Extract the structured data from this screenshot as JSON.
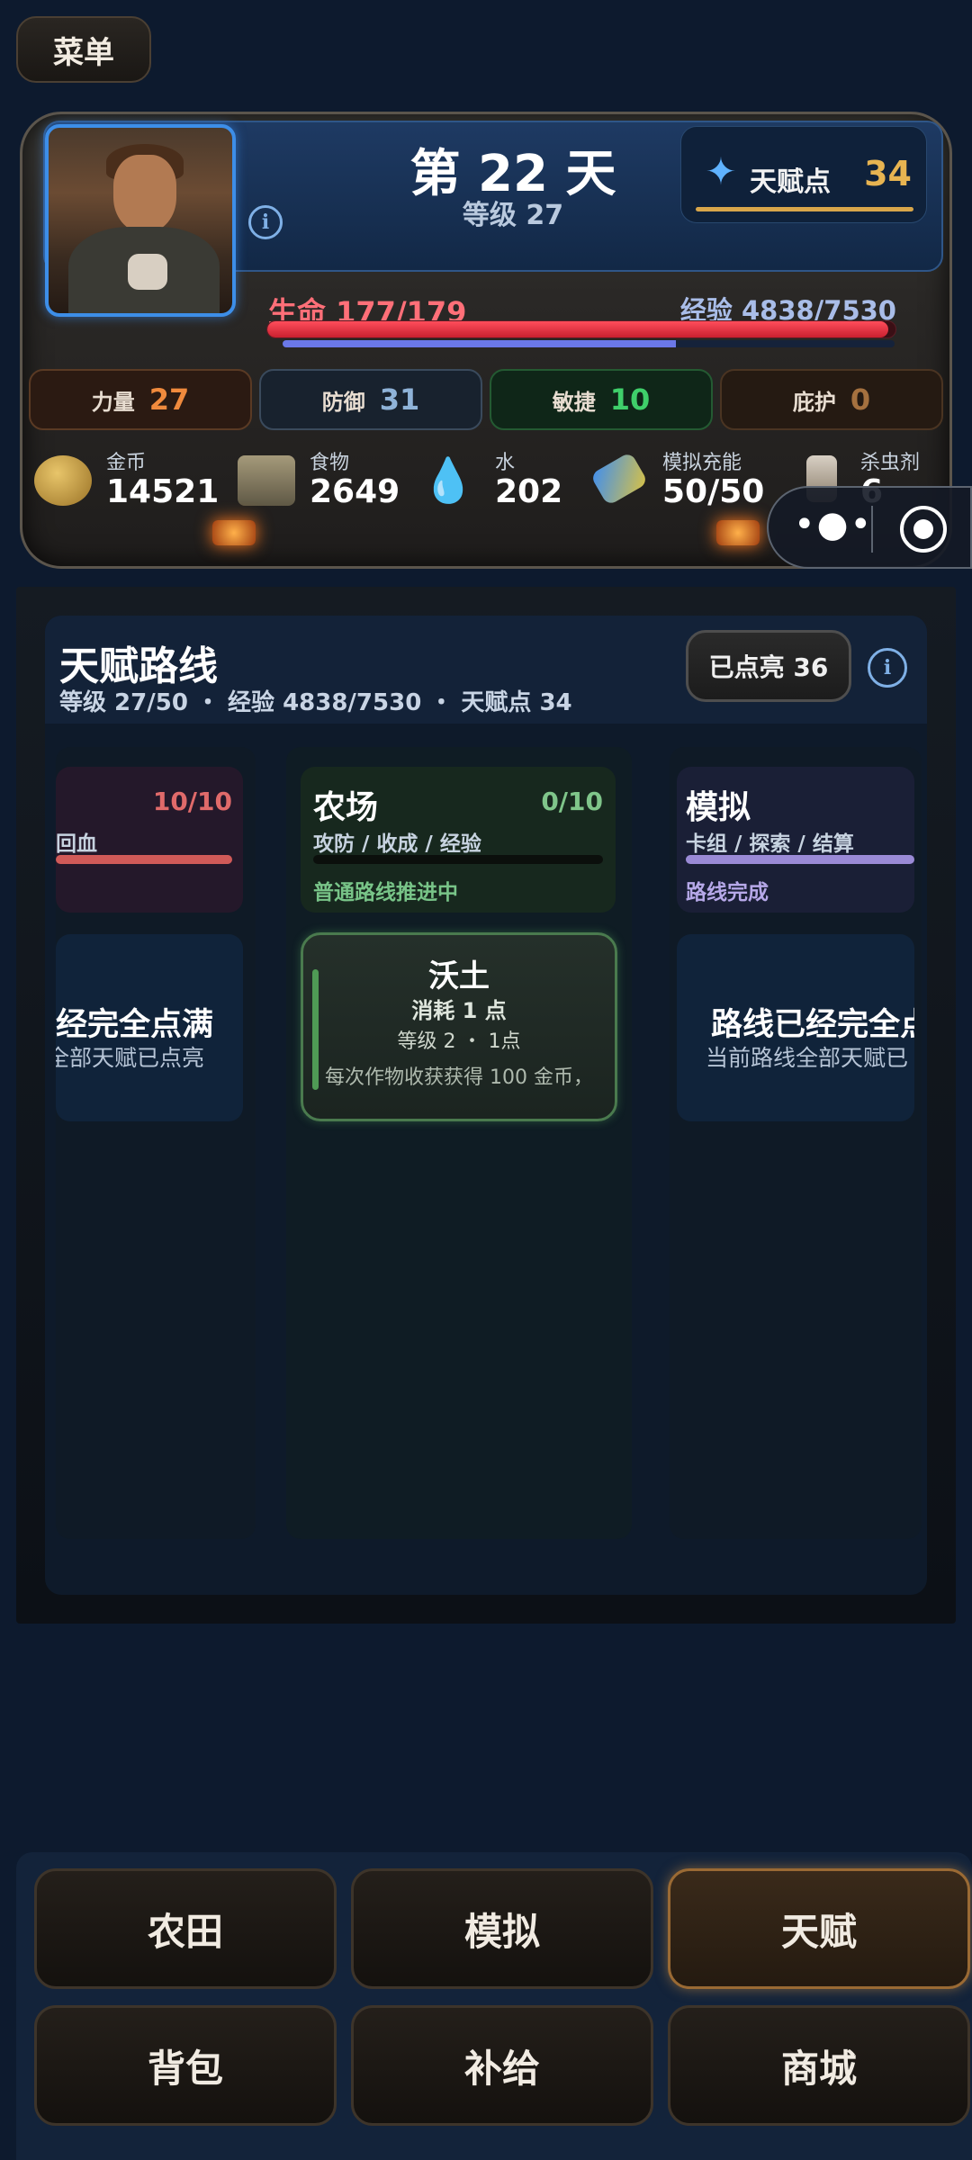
{
  "menu": {
    "label": "菜单"
  },
  "header": {
    "day": "第 22 天",
    "level": "等级 27",
    "talent_points_label": "天赋点",
    "talent_points_value": "34"
  },
  "vitals": {
    "hp_label": "生命 177/179",
    "hp_fraction": 0.989,
    "exp_label": "经验 4838/7530",
    "exp_fraction": 0.642
  },
  "stats": [
    {
      "name": "力量",
      "value": "27"
    },
    {
      "name": "防御",
      "value": "31"
    },
    {
      "name": "敏捷",
      "value": "10"
    },
    {
      "name": "庇护",
      "value": "0"
    }
  ],
  "resources": [
    {
      "name": "金币",
      "value": "14521",
      "icon": "gold-coins-icon"
    },
    {
      "name": "食物",
      "value": "2649",
      "icon": "food-crate-icon"
    },
    {
      "name": "水",
      "value": "202",
      "icon": "water-drop-icon"
    },
    {
      "name": "模拟充能",
      "value": "50/50",
      "icon": "battery-icon"
    },
    {
      "name": "杀虫剂",
      "value": "6",
      "icon": "spray-bottle-icon"
    }
  ],
  "talent_routes": {
    "title": "天赋路线",
    "subtitle": "等级 27/50 ・ 经验 4838/7530 ・ 天赋点 34",
    "lit_label": "已点亮 36",
    "routes": [
      {
        "title": "",
        "count": "10/10",
        "tags": "回血",
        "status": ""
      },
      {
        "title": "农场",
        "count": "0/10",
        "tags": "攻防 / 收成 / 经验",
        "status": "普通路线推进中",
        "progress": 0.0
      },
      {
        "title": "模拟",
        "count": "",
        "tags": "卡组 / 探索 / 结算",
        "status": "路线完成"
      }
    ],
    "left_full": {
      "title": "经完全点满",
      "desc": "全部天赋已点亮"
    },
    "right_full": {
      "title": "路线已经完全点",
      "desc": "当前路线全部天赋已"
    },
    "node": {
      "title": "沃土",
      "cost": "消耗 1 点",
      "level": "等级 2 ・ 1点",
      "desc": "每次作物收获获得 100 金币，"
    }
  },
  "nav": {
    "farm": "农田",
    "simulate": "模拟",
    "talent": "天赋",
    "bag": "背包",
    "supply": "补给",
    "shop": "商城"
  },
  "colors": {
    "hp": "#ff4d5b",
    "exp": "#6b78e8",
    "talent_gold": "#e7b451",
    "active_nav_border": "#9a6a34"
  }
}
